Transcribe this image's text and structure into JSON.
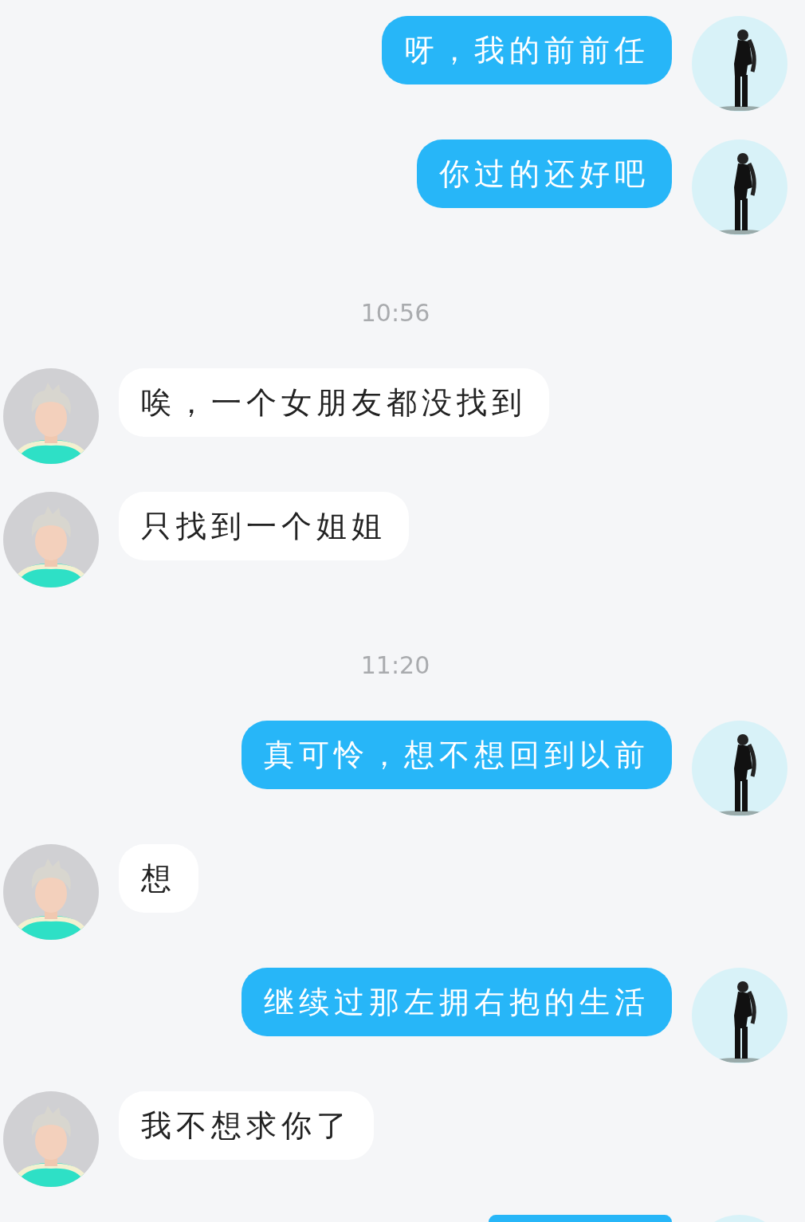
{
  "messages": [
    {
      "kind": "sent",
      "text": "呀，我的前前任"
    },
    {
      "kind": "sent",
      "text": "你过的还好吧"
    },
    {
      "kind": "time",
      "text": "10:56"
    },
    {
      "kind": "received",
      "text": "唉，一个女朋友都没找到"
    },
    {
      "kind": "received",
      "text": "只找到一个姐姐"
    },
    {
      "kind": "time",
      "text": "11:20"
    },
    {
      "kind": "sent",
      "text": "真可怜，想不想回到以前"
    },
    {
      "kind": "received",
      "text": "想"
    },
    {
      "kind": "sent",
      "text": "继续过那左拥右抱的生活"
    },
    {
      "kind": "received",
      "text": "我不想求你了"
    },
    {
      "kind": "sent",
      "partial": true
    }
  ]
}
